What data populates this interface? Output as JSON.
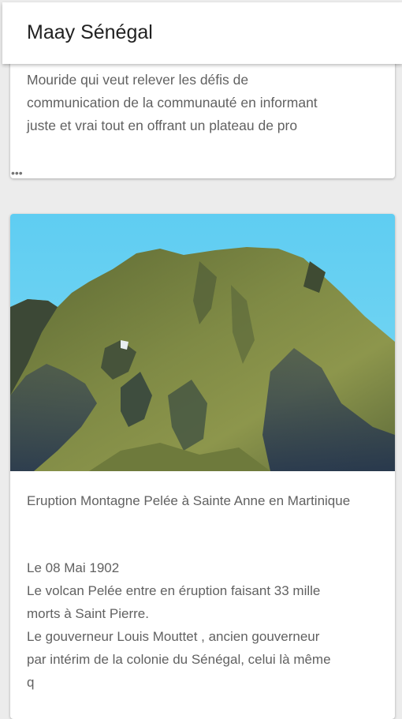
{
  "appbar": {
    "title": "Maay Sénégal"
  },
  "posts": [
    {
      "excerpt_lines": [
        "Mouride qui veut relever les défis de",
        "communication de la communauté en informant",
        "juste et vrai tout en offrant un plateau de pro"
      ],
      "more": "•••"
    },
    {
      "image_alt": "Montagne Pelée",
      "title": "Eruption Montagne Pelée à Sainte Anne en Martinique",
      "body_lines": [
        "Le 08 Mai 1902",
        "Le volcan Pelée entre en éruption faisant 33 mille",
        "morts à Saint Pierre.",
        "Le gouverneur Louis Mouttet , ancien gouverneur",
        "par intérim de la colonie du Sénégal, celui là même",
        "q"
      ]
    }
  ],
  "colors": {
    "background": "#ececec",
    "card": "#ffffff",
    "text": "#616161",
    "title_text": "#212121",
    "sky": "#5cc8ec",
    "mountain": "#6f7a3a"
  }
}
